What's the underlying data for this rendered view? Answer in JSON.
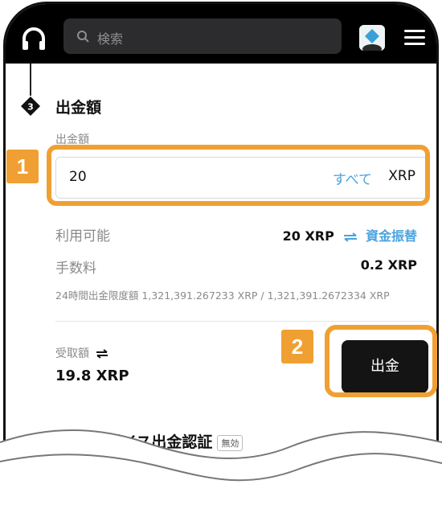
{
  "header": {
    "search_placeholder": "検索"
  },
  "withdraw": {
    "step_number": "3",
    "section_title": "出金額",
    "amount_label": "出金額",
    "amount_value": "20",
    "all_label": "すべて",
    "unit": "XRP",
    "available_label": "利用可能",
    "available_value": "20 XRP",
    "transfer_label": "資金振替",
    "fee_label": "手数料",
    "fee_value": "0.2 XRP",
    "limit_text": "24時間出金限度額  1,321,391.267233 XRP / 1,321,391.2672334 XRP",
    "receive_label": "受取額",
    "receive_value": "19.8 XRP",
    "withdraw_button": "出金"
  },
  "auth": {
    "title": "パスキーデバイス出金認証",
    "status": "無効"
  },
  "callouts": {
    "one": "1",
    "two": "2"
  },
  "colors": {
    "accent": "#f0a033",
    "link": "#4aa3df",
    "topbar": "#000000"
  }
}
